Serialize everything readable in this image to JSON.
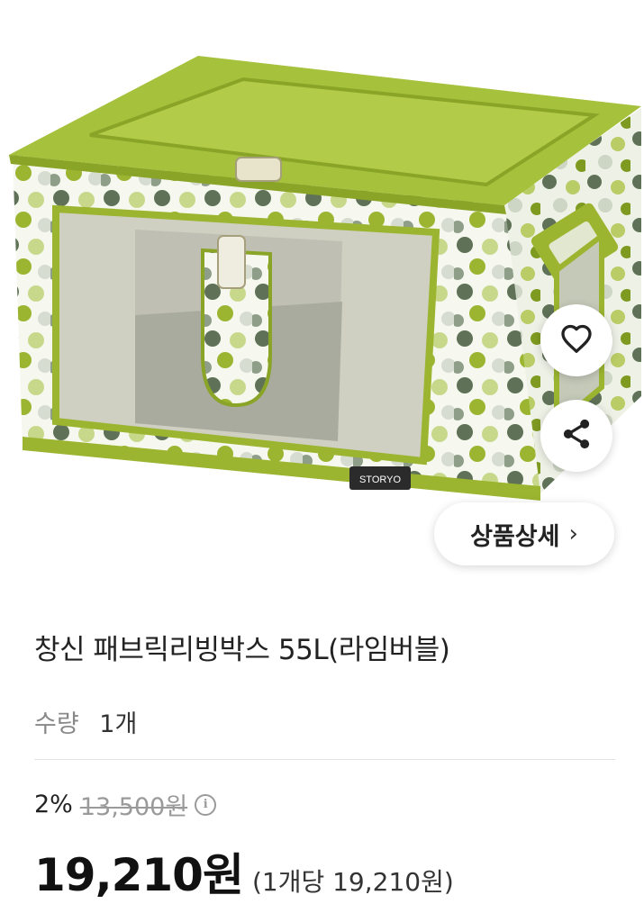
{
  "product": {
    "image_brand_tag": "STORYO",
    "title": "창신 패브릭리빙박스 55L(라임버블)",
    "detail_button_label": "상품상세",
    "detail_chevron": "›",
    "quantity_label": "수량",
    "quantity_value": "1개",
    "discount_rate": "2%",
    "original_price": "13,500원",
    "info_icon_glyph": "i",
    "price": "19,210원",
    "unit_price": "(1개당 19,210원)"
  },
  "icons": {
    "like": "heart-icon",
    "share": "share-icon",
    "info": "info-icon"
  },
  "colors": {
    "lime": "#9bb531",
    "lime_dark": "#7f9a20",
    "dot_dark": "#5f7257",
    "dot_light": "#c8d88a"
  }
}
